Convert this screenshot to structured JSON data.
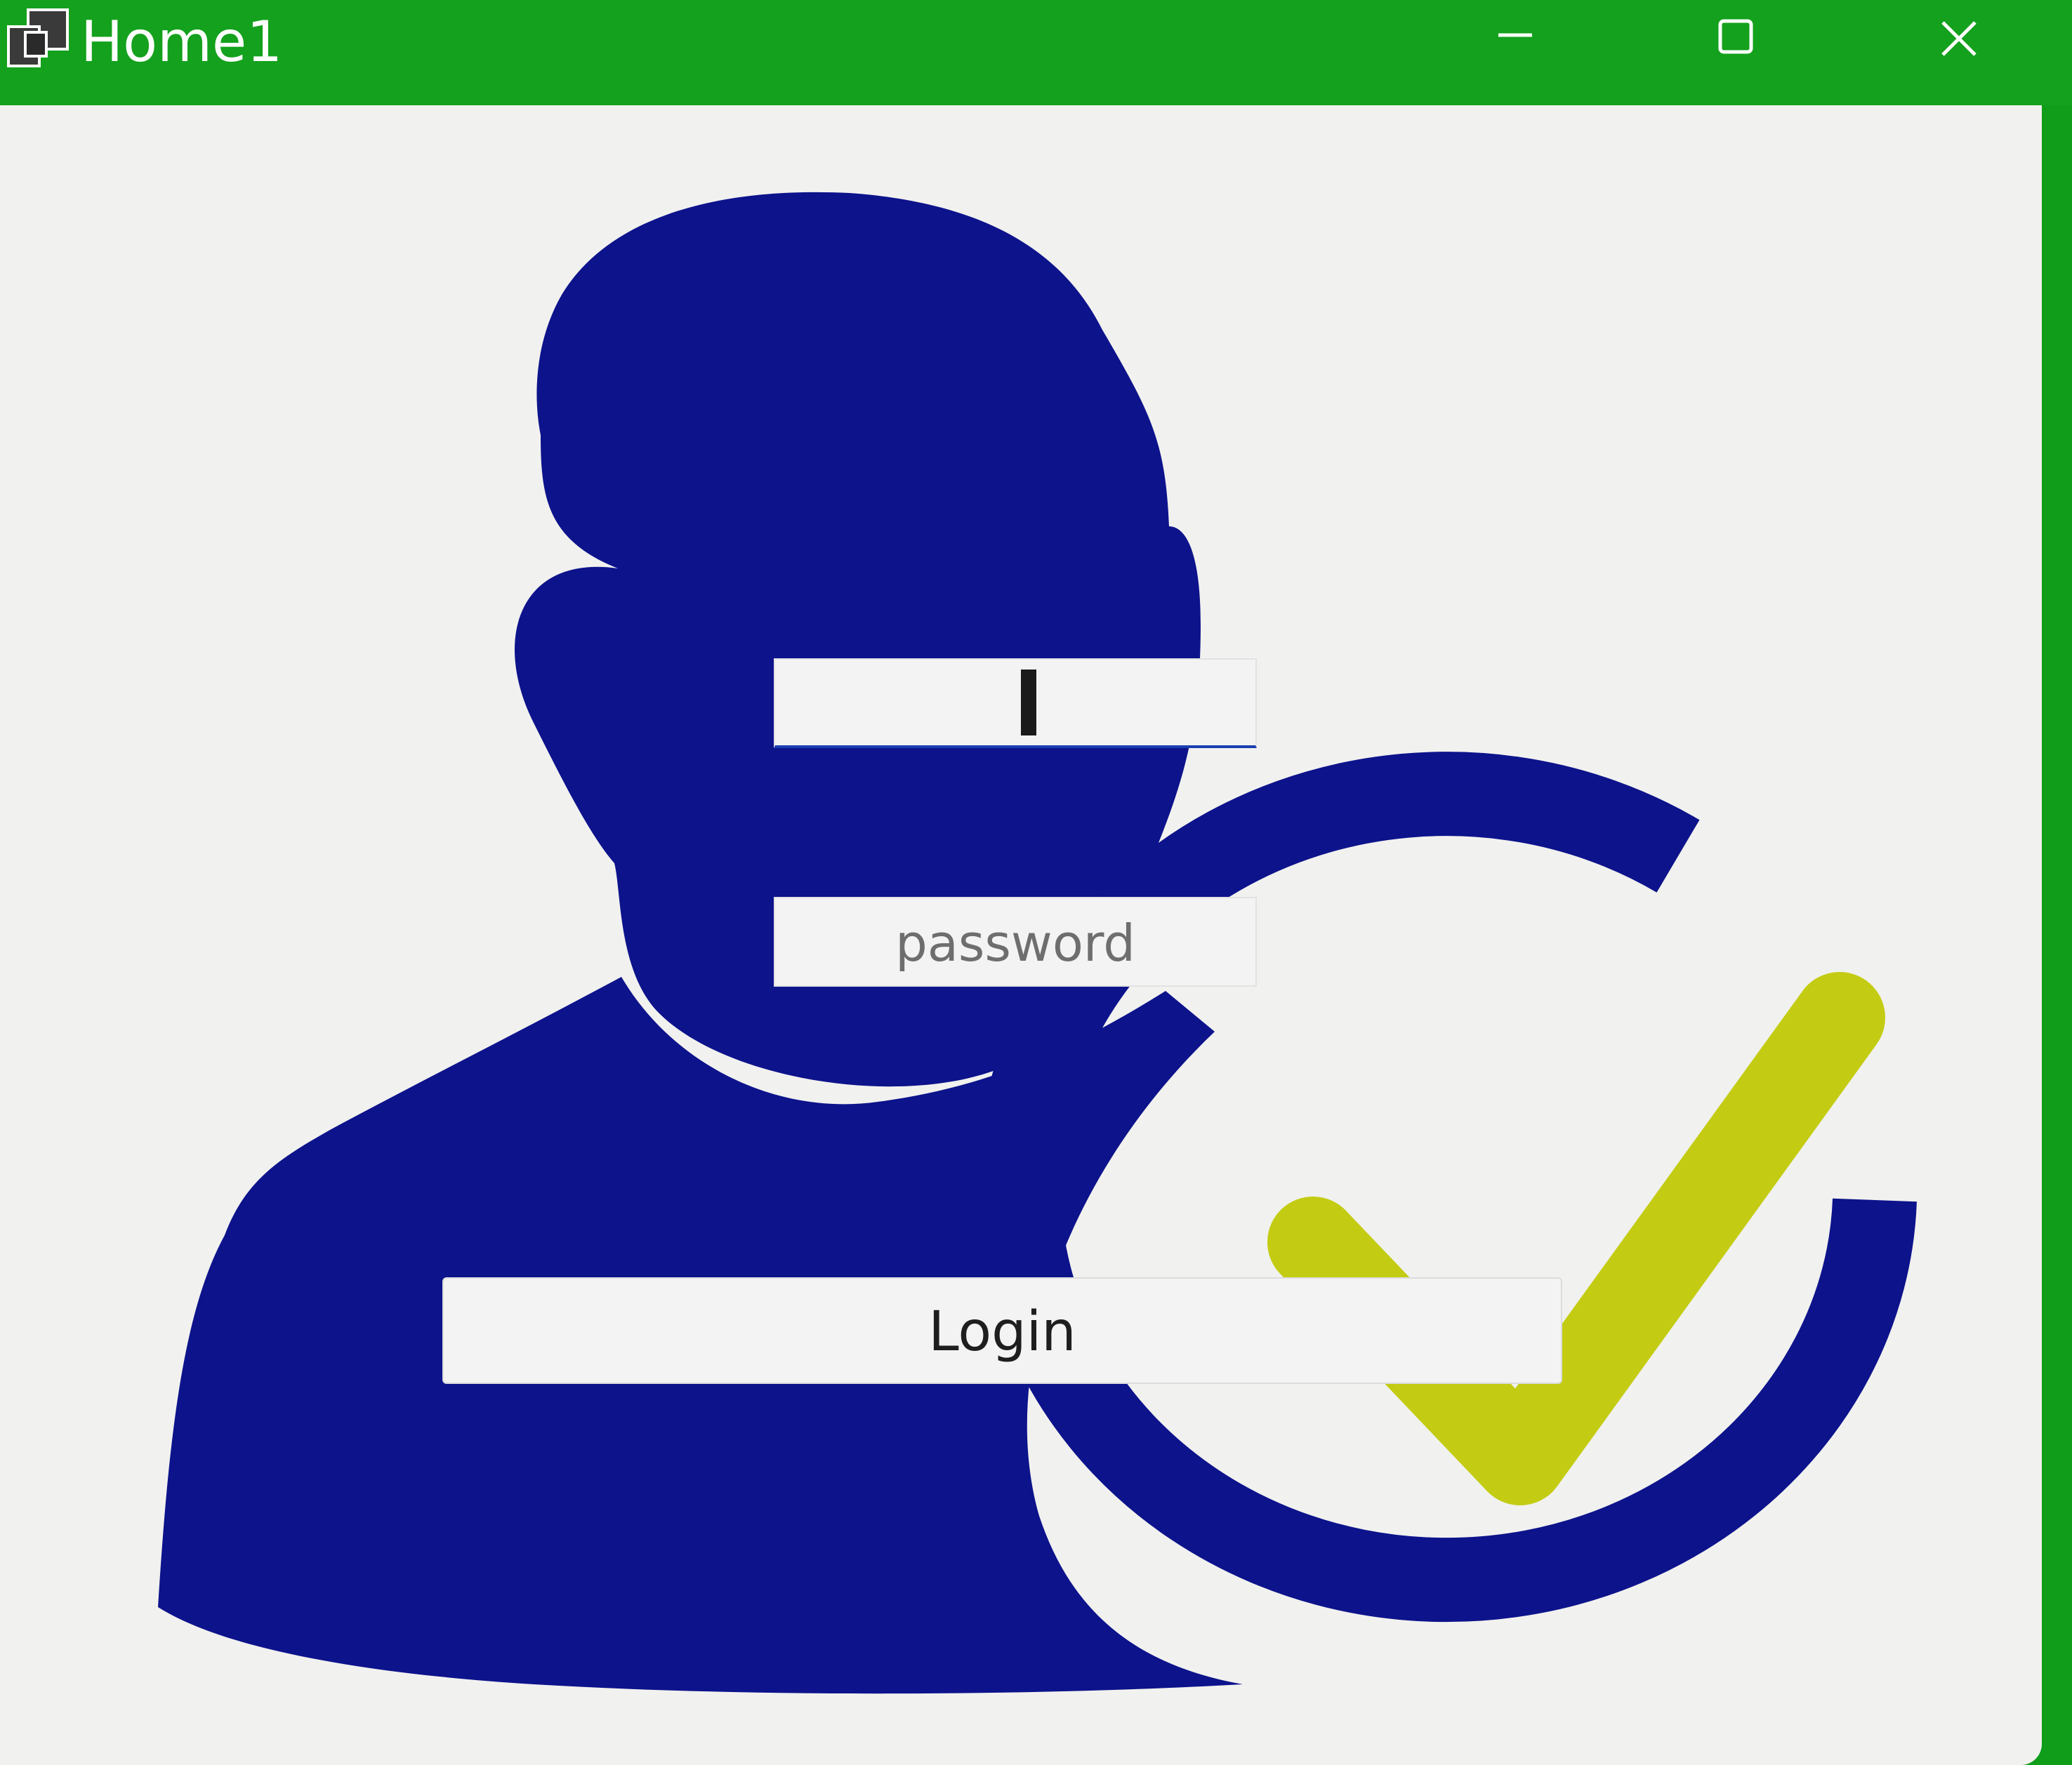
{
  "window": {
    "title": "Home1",
    "title_bar_color": "#14a11d"
  },
  "login_form": {
    "username": {
      "value": "",
      "placeholder": ""
    },
    "password": {
      "placeholder": "password"
    },
    "login_button_label": "Login"
  },
  "illustration": {
    "icon": "user-check-icon",
    "figure_color": "#0d138b",
    "check_color": "#c3cc12"
  }
}
